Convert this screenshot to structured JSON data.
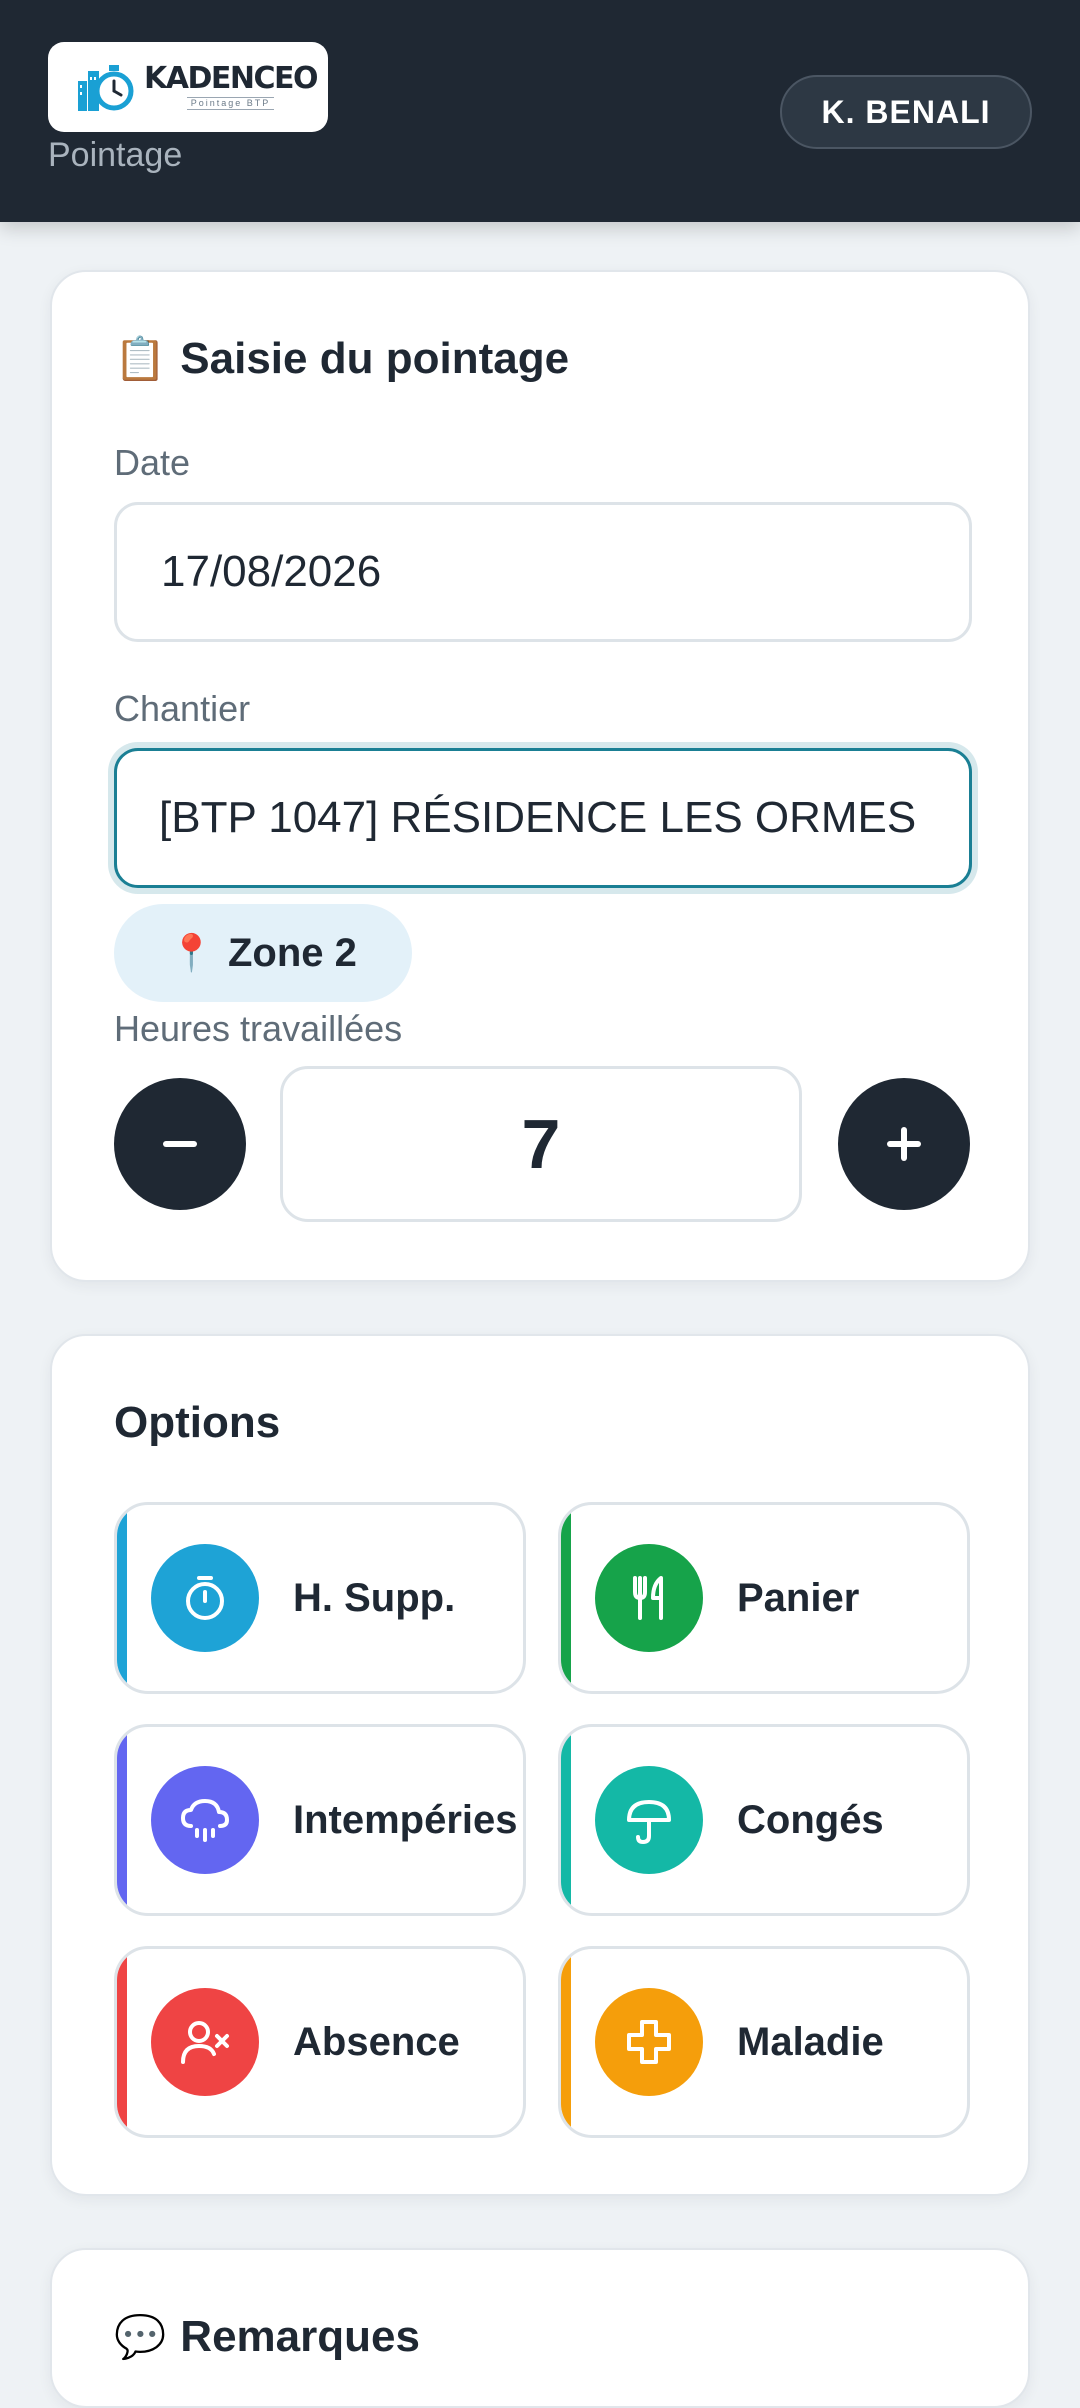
{
  "header": {
    "logo_name": "KADENCEO",
    "logo_tagline": "Pointage BTP",
    "subtitle": "Pointage",
    "user_label": "K. BENALI"
  },
  "entry": {
    "title": "Saisie du pointage",
    "title_emoji": "📋",
    "date_label": "Date",
    "date_value": "17/08/2026",
    "site_label": "Chantier",
    "site_value": "[BTP 1047] RÉSIDENCE LES ORMES",
    "zone_pin": "📍",
    "zone_label": "Zone 2",
    "hours_label": "Heures travaillées",
    "hours_value": "7",
    "decrement_icon": "minus-icon",
    "increment_icon": "plus-icon"
  },
  "options": {
    "title": "Options",
    "items": [
      {
        "label": "H. Supp.",
        "icon": "stopwatch-icon",
        "color": "#1ea3d6"
      },
      {
        "label": "Panier",
        "icon": "utensils-icon",
        "color": "#16a34a"
      },
      {
        "label": "Intempéries",
        "icon": "rain-cloud-icon",
        "color": "#6366f1"
      },
      {
        "label": "Congés",
        "icon": "umbrella-icon",
        "color": "#14b8a6"
      },
      {
        "label": "Absence",
        "icon": "user-x-icon",
        "color": "#ef4444"
      },
      {
        "label": "Maladie",
        "icon": "medical-cross-icon",
        "color": "#f59e0b"
      }
    ]
  },
  "remarks": {
    "title": "Remarques",
    "title_emoji": "💬"
  }
}
